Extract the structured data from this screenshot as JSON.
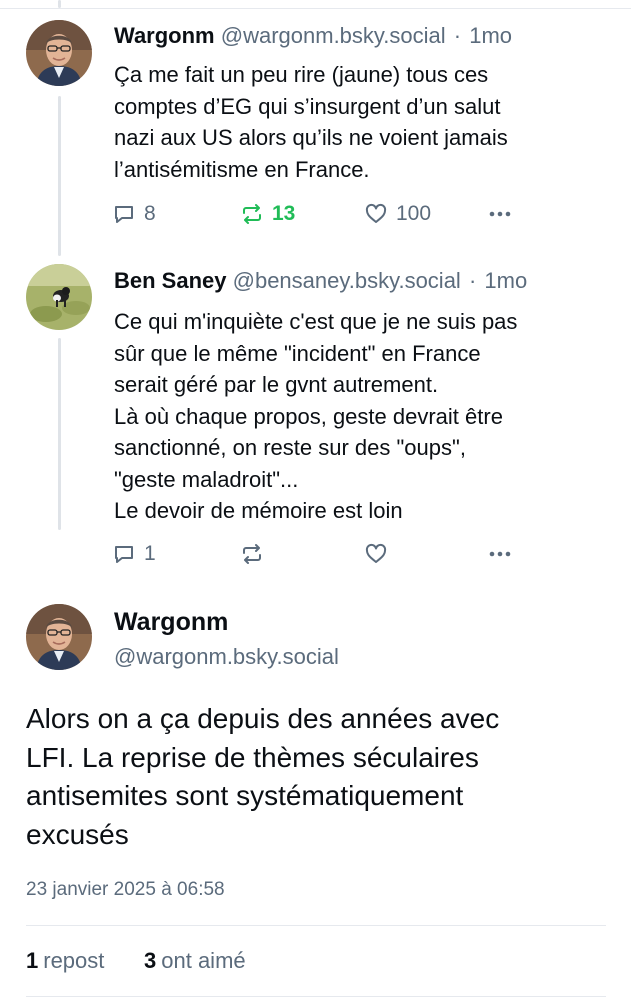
{
  "replies": [
    {
      "display_name": "Wargonm",
      "handle": "@wargonm.bsky.social",
      "separator": "·",
      "age": "1mo",
      "text": "Ça me fait un peu rire (jaune)  tous ces\ncomptes d’EG qui s’insurgent d’un salut\nnazi aux US alors qu’ils ne voient jamais\nl’antisémitisme en France.",
      "reply_count": "8",
      "repost_count": "13",
      "like_count": "100"
    },
    {
      "display_name": "Ben Saney",
      "handle": "@bensaney.bsky.social",
      "separator": "·",
      "age": "1mo",
      "text": "Ce qui m'inquiète c'est que je ne suis pas\nsûr que le même \"incident\" en France\nserait géré par le gvnt autrement.\nLà où chaque propos, geste devrait être\nsanctionné, on reste sur des \"oups\",\n\"geste maladroit\"...\nLe devoir de mémoire est loin",
      "reply_count": "1",
      "repost_count": "",
      "like_count": ""
    }
  ],
  "main_post": {
    "display_name": "Wargonm",
    "handle": "@wargonm.bsky.social",
    "text": "Alors on a ça depuis des années avec\nLFI. La reprise de thèmes séculaires\nantisemites sont systématiquement\nexcusés",
    "timestamp": "23 janvier 2025 à 06:58",
    "repost_count": "1",
    "repost_label": "repost",
    "like_count": "3",
    "like_label": "ont aimé"
  },
  "colors": {
    "text": "#0b0f14",
    "muted": "#5b6b7c",
    "repost_active": "#20bc57",
    "thread_line": "#dfe3e8",
    "divider": "#e6e9ee"
  },
  "icons": [
    "reply-icon",
    "repost-icon",
    "like-icon",
    "more-icon"
  ]
}
